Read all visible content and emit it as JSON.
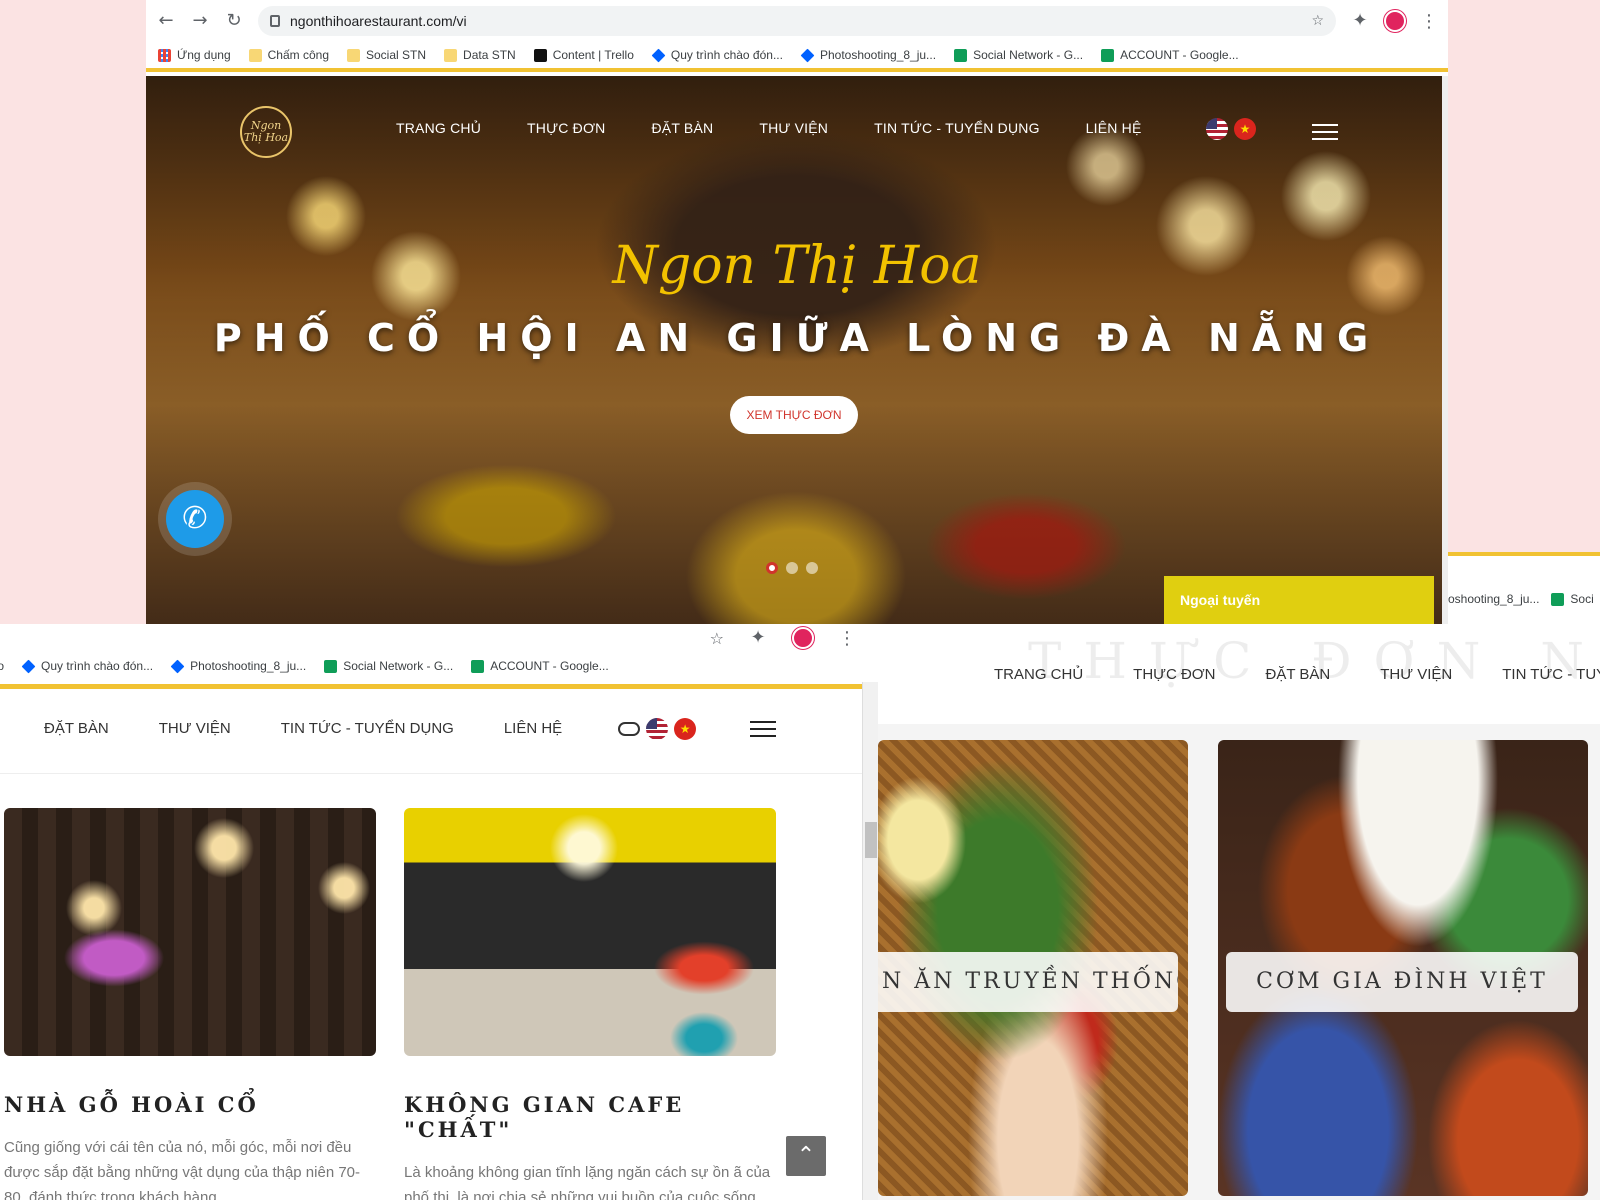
{
  "top_window": {
    "url": "ngonthihoarestaurant.com/vi",
    "bookmarks": [
      {
        "label": "Ứng dụng",
        "icon": "apps-icon"
      },
      {
        "label": "Chấm công",
        "icon": "folder-icon"
      },
      {
        "label": "Social STN",
        "icon": "folder-icon"
      },
      {
        "label": "Data STN",
        "icon": "folder-icon"
      },
      {
        "label": "Content | Trello",
        "icon": "trello-icon"
      },
      {
        "label": "Quy trình chào đón...",
        "icon": "dropbox-icon"
      },
      {
        "label": "Photoshooting_8_ju...",
        "icon": "dropbox-icon"
      },
      {
        "label": "Social Network - G...",
        "icon": "sheets-icon"
      },
      {
        "label": "ACCOUNT - Google...",
        "icon": "sheets-icon"
      }
    ],
    "logo_text": "Ngon Thị Hoa",
    "nav": [
      "TRANG CHỦ",
      "THỰC ĐƠN",
      "ĐẶT BÀN",
      "THƯ VIỆN",
      "TIN TỨC - TUYỂN DỤNG",
      "LIÊN HỆ"
    ],
    "script_title": "Ngon Thị Hoa",
    "headline": "PHỐ CỔ HỘI AN GIỮA LÒNG ĐÀ NẴNG",
    "cta": "XEM THỰC ĐƠN",
    "offline_tab": "Ngoại tuyến",
    "slider_dots": 3,
    "active_dot": 1
  },
  "bottom_left_window": {
    "bookmarks": [
      "llo",
      "Quy trình chào đón...",
      "Photoshooting_8_ju...",
      "Social Network - G...",
      "ACCOUNT - Google..."
    ],
    "nav": [
      "ĐẶT BÀN",
      "THƯ VIỆN",
      "TIN TỨC - TUYỂN DỤNG",
      "LIÊN HỆ"
    ],
    "cards": [
      {
        "title": "NHÀ GỖ HOÀI CỔ",
        "text": "Cũng giống với cái tên của nó, mỗi góc, mỗi nơi đều được sắp đặt bằng những vật dụng của thập niên 70-80, đánh thức trong khách hàng"
      },
      {
        "title": "KHÔNG GIAN CAFE \"CHẤT\"",
        "text": "Là khoảng không gian tĩnh lặng ngăn cách sự ồn ã của phố thị, là nơi chia sẻ những vui buồn của cuộc sống bộn bề, là góc khuất để bạn hồi tưởng"
      }
    ],
    "back_to_top": "⌃"
  },
  "bottom_right_window": {
    "watermark": "THỰC ĐƠN NHÀ H",
    "nav": [
      "TRANG CHỦ",
      "THỰC ĐƠN",
      "ĐẶT BÀN",
      "THƯ VIỆN",
      "TIN TỨC - TUYỂ"
    ],
    "menu_cards": [
      "N ĂN TRUYỀN THỐNG",
      "CƠM GIA ĐÌNH VIỆT"
    ]
  },
  "side_strip": [
    "oshooting_8_ju...",
    "Soci"
  ],
  "colors": {
    "accent_yellow": "#f1c232",
    "cta_red": "#d0342c",
    "call_blue": "#1e9be8",
    "offline_yellow": "#e0cf10",
    "script_gold": "#f2c200",
    "background_pink": "#fbe3e3"
  }
}
